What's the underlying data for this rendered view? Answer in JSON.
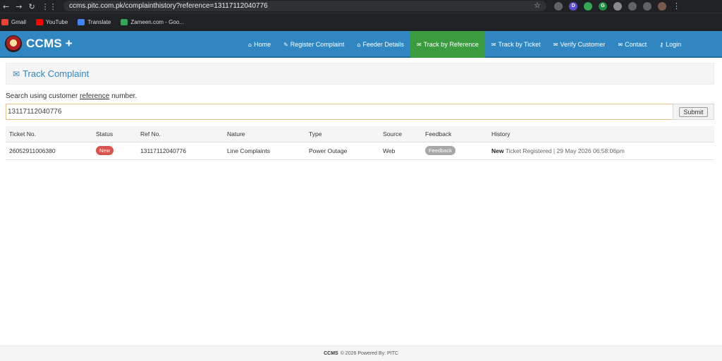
{
  "browser": {
    "url": "ccms.pitc.com.pk/complainthistory?reference=13117112040776",
    "nav": {
      "back": "←",
      "forward": "→",
      "reload": "↻",
      "apps": "⋮⋮"
    },
    "star": "☆",
    "bookmarks": [
      {
        "label": "Gmail",
        "color": "#ea4335"
      },
      {
        "label": "YouTube",
        "color": "#ff0000"
      },
      {
        "label": "Translate",
        "color": "#4285f4"
      },
      {
        "label": "Zameen.com - Goo...",
        "color": "#34a853"
      }
    ],
    "menu": "⋮"
  },
  "header": {
    "brand": "CCMS +",
    "nav": [
      {
        "label": "Home",
        "icon": "⌂",
        "icon_name": "home-icon",
        "active": false
      },
      {
        "label": "Register Complaint",
        "icon": "✎",
        "icon_name": "comments-icon",
        "active": false
      },
      {
        "label": "Feeder Details",
        "icon": "⌂",
        "icon_name": "home-icon",
        "active": false
      },
      {
        "label": "Track by Reference",
        "icon": "✉",
        "icon_name": "comments-icon",
        "active": true
      },
      {
        "label": "Track by Ticket",
        "icon": "✉",
        "icon_name": "comments-icon",
        "active": false
      },
      {
        "label": "Verify Customer",
        "icon": "✉",
        "icon_name": "comments-icon",
        "active": false
      },
      {
        "label": "Contact",
        "icon": "✉",
        "icon_name": "envelope-icon",
        "active": false
      },
      {
        "label": "Login",
        "icon": "⚷",
        "icon_name": "key-icon",
        "active": false
      }
    ]
  },
  "page": {
    "title": "Track Complaint",
    "title_icon": "✉",
    "search_label_pre": "Search using customer ",
    "search_label_em": "reference",
    "search_label_post": " number.",
    "search_value": "13117112040776",
    "submit_label": "Submit"
  },
  "table": {
    "headers": [
      "Ticket No.",
      "Status",
      "Ref No.",
      "Nature",
      "Type",
      "Source",
      "Feedback",
      "History"
    ],
    "rows": [
      {
        "ticket_no": "26052911006380",
        "status": "New",
        "ref_no": "13117112040776",
        "nature": "Line Complaints",
        "type": "Power Outage",
        "source": "Web",
        "feedback": "Feedback",
        "history_strong": "New",
        "history_rest": "Ticket Registered | 29 May 2026 06:58:06pm"
      }
    ]
  },
  "footer": {
    "brand": "CCMS",
    "text": "© 2026 Powered By: PITC"
  },
  "colors": {
    "header_bg": "#2f86c1",
    "active_nav": "#3b9c3f",
    "badge_new": "#d9534f",
    "badge_feedback": "#a7a7a7"
  }
}
